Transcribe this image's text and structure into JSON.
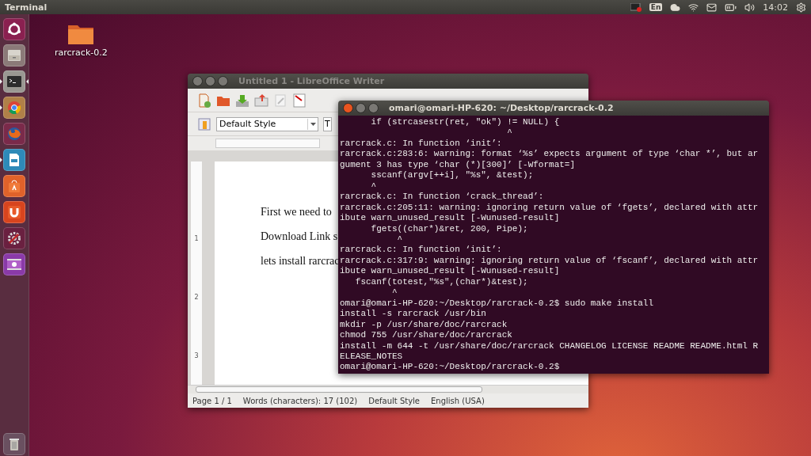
{
  "top_bar": {
    "title": "Terminal",
    "keyboard": "En",
    "time": "14:02"
  },
  "launcher": {
    "items": [
      {
        "kind": "dash",
        "running": false,
        "focused": false
      },
      {
        "kind": "files",
        "running": false,
        "focused": false
      },
      {
        "kind": "terminal",
        "running": true,
        "focused": true
      },
      {
        "kind": "browser",
        "running": true,
        "focused": false
      },
      {
        "kind": "firefox",
        "running": false,
        "focused": false
      },
      {
        "kind": "writer",
        "running": true,
        "focused": false
      },
      {
        "kind": "store",
        "running": false,
        "focused": false
      },
      {
        "kind": "cloud",
        "running": false,
        "focused": false
      },
      {
        "kind": "settings",
        "running": false,
        "focused": false
      },
      {
        "kind": "media",
        "running": false,
        "focused": false
      },
      {
        "kind": "trash",
        "running": false,
        "focused": false
      }
    ]
  },
  "desktop_icons": [
    {
      "label": "rarcrack-0.2"
    }
  ],
  "writer": {
    "title": "Untitled 1 - LibreOffice Writer",
    "active": false,
    "paragraph_style": "Default Style",
    "font_name": "T",
    "ruler_numbers": [
      "1",
      "2",
      "3"
    ],
    "paragraphs": [
      "First we need to",
      "Download Link s",
      "lets install rarcrac"
    ],
    "status": [
      "Page 1 / 1",
      "Words (characters): 17 (102)",
      "Default Style",
      "English (USA)"
    ]
  },
  "terminal": {
    "title": "omari@omari-HP-620: ~/Desktop/rarcrack-0.2",
    "active": true,
    "lines": [
      "      if (strcasestr(ret, \"ok\") != NULL) {",
      "                                ^",
      "rarcrack.c: In function ‘init’:",
      "rarcrack.c:283:6: warning: format ‘%s’ expects argument of type ‘char *’, but ar",
      "gument 3 has type ‘char (*)[300]’ [-Wformat=]",
      "      sscanf(argv[++i], \"%s\", &test);",
      "      ^",
      "rarcrack.c: In function ‘crack_thread’:",
      "rarcrack.c:205:11: warning: ignoring return value of ‘fgets’, declared with attr",
      "ibute warn_unused_result [-Wunused-result]",
      "      fgets((char*)&ret, 200, Pipe);",
      "           ^",
      "rarcrack.c: In function ‘init’:",
      "rarcrack.c:317:9: warning: ignoring return value of ‘fscanf’, declared with attr",
      "ibute warn_unused_result [-Wunused-result]",
      "   fscanf(totest,\"%s\",(char*)&test);",
      "          ^",
      "omari@omari-HP-620:~/Desktop/rarcrack-0.2$ sudo make install",
      "install -s rarcrack /usr/bin",
      "mkdir -p /usr/share/doc/rarcrack",
      "chmod 755 /usr/share/doc/rarcrack",
      "install -m 644 -t /usr/share/doc/rarcrack CHANGELOG LICENSE README README.html R",
      "ELEASE_NOTES",
      "omari@omari-HP-620:~/Desktop/rarcrack-0.2$"
    ]
  }
}
